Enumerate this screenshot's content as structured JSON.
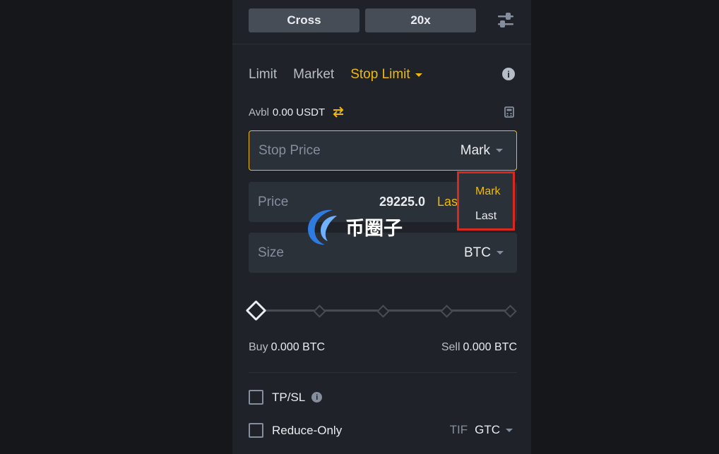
{
  "margin": {
    "mode_label": "Cross",
    "leverage_label": "20x"
  },
  "order_tabs": {
    "limit": "Limit",
    "market": "Market",
    "stop_limit": "Stop Limit"
  },
  "available": {
    "label": "Avbl",
    "value": "0.00 USDT"
  },
  "stop_price": {
    "label": "Stop Price",
    "trigger": "Mark"
  },
  "trigger_dropdown": {
    "options": [
      "Mark",
      "Last"
    ],
    "selected": "Mark"
  },
  "price": {
    "label": "Price",
    "value": "29225.0",
    "trigger_partial": "Las"
  },
  "size": {
    "label": "Size",
    "unit": "BTC"
  },
  "slider": {
    "percent": 0,
    "marks": [
      0,
      25,
      50,
      75,
      100
    ]
  },
  "buy": {
    "label": "Buy",
    "value": "0.000 BTC"
  },
  "sell": {
    "label": "Sell",
    "value": "0.000 BTC"
  },
  "options": {
    "tpsl_label": "TP/SL",
    "reduce_only_label": "Reduce-Only",
    "tif_label": "TIF",
    "tif_value": "GTC"
  },
  "watermark": {
    "text": "币圈子"
  },
  "colors": {
    "accent": "#f0b90b",
    "panel": "#1f2329",
    "input": "#2b3139",
    "highlight_box": "#d9291f"
  }
}
